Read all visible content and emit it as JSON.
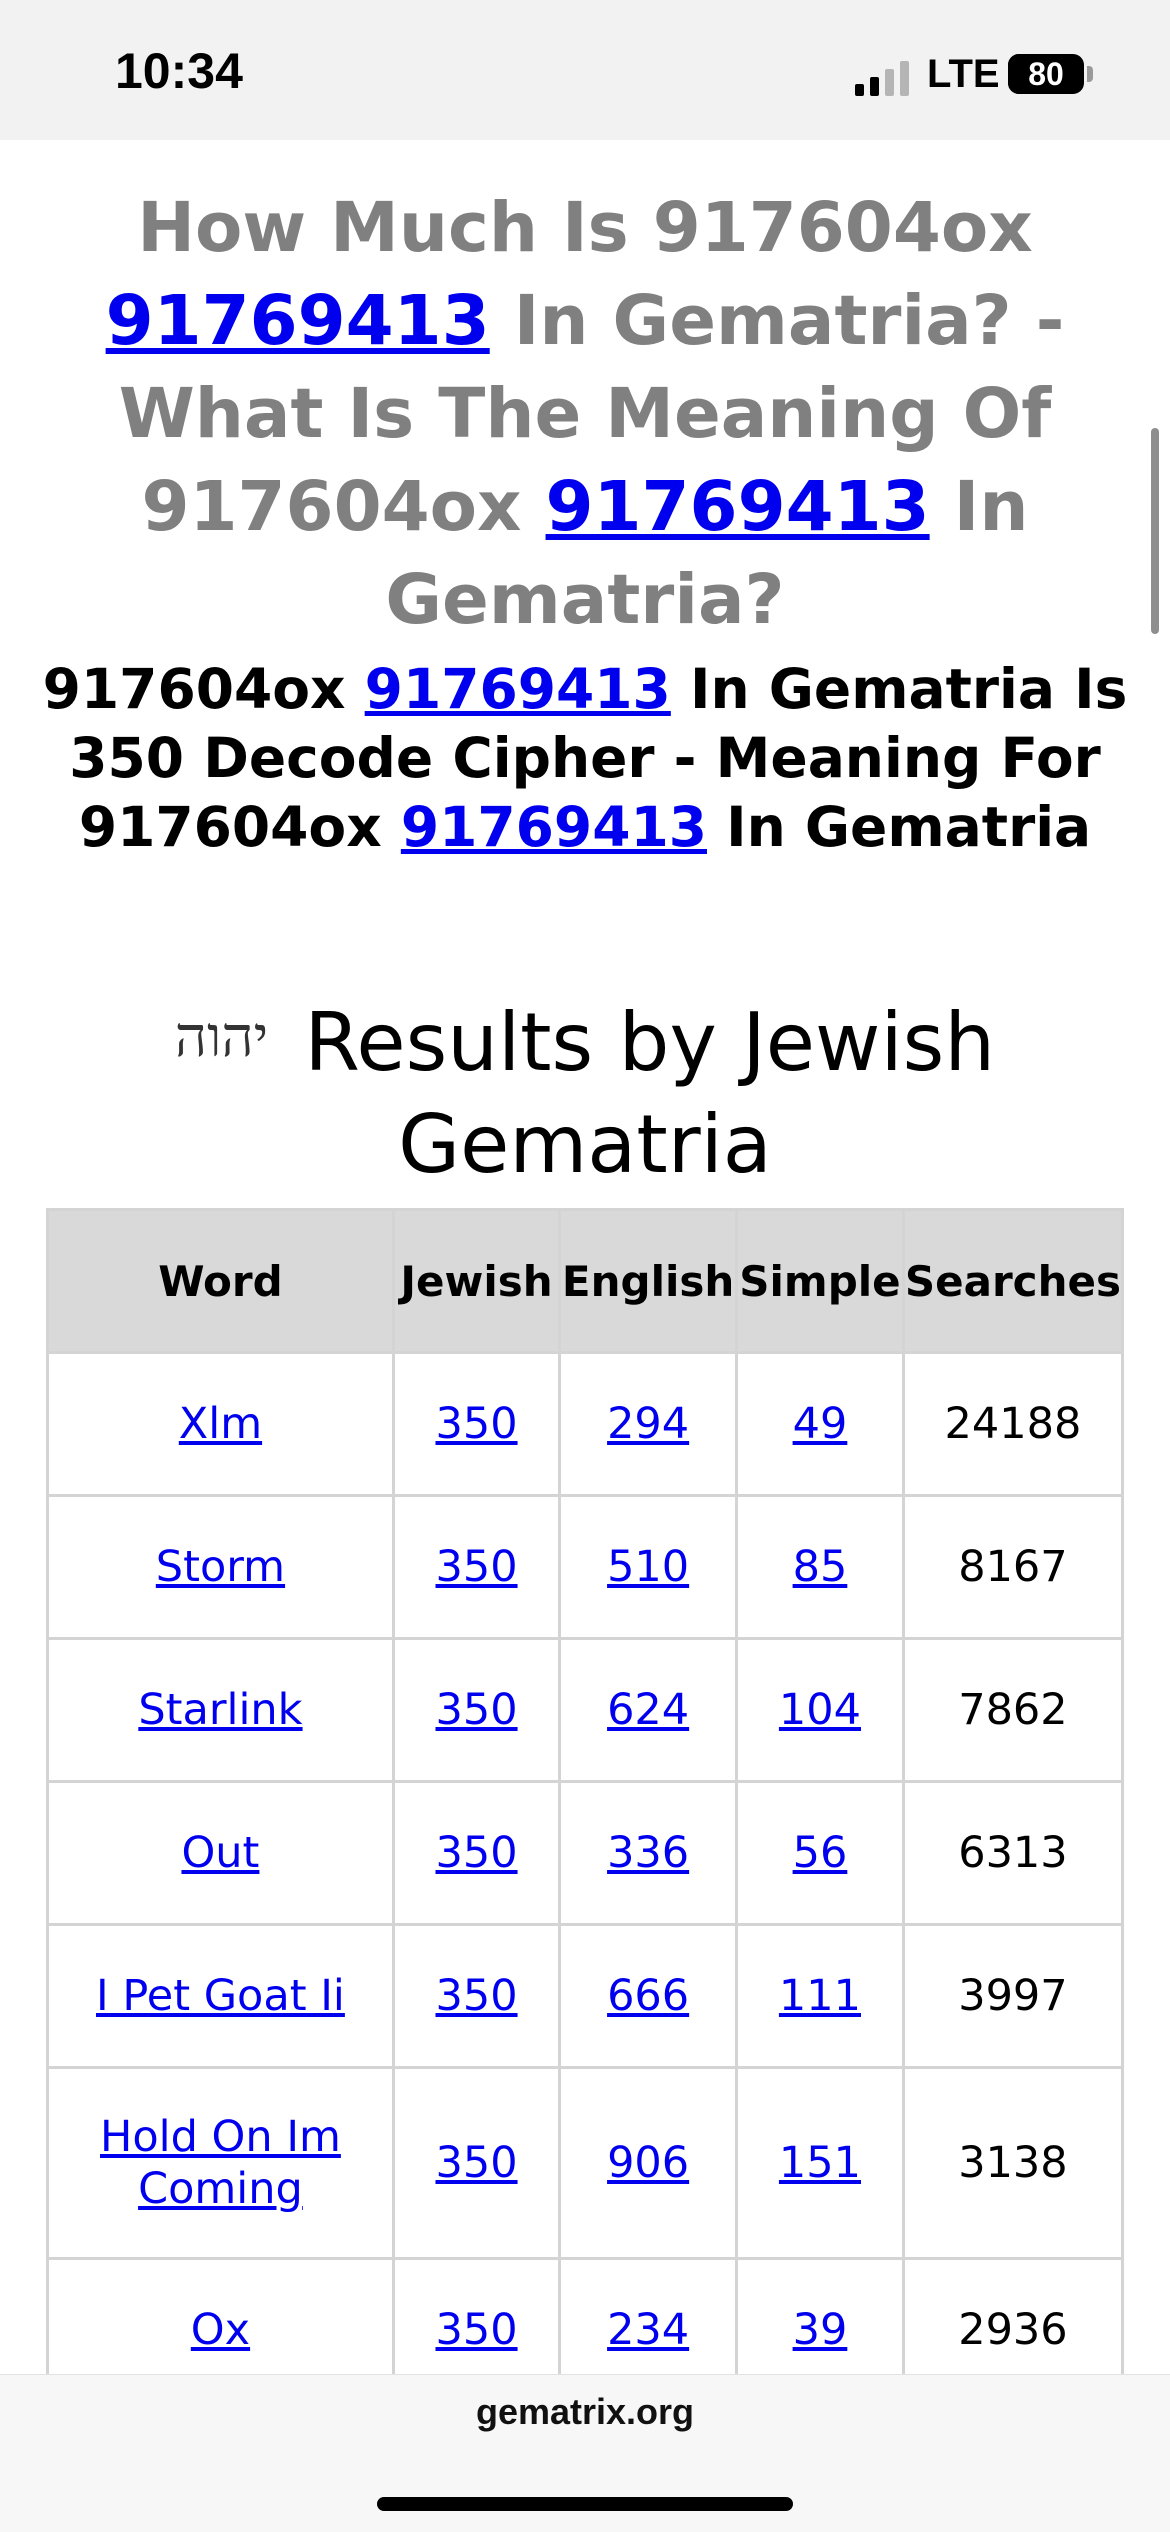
{
  "status_bar": {
    "time": "10:34",
    "network": "LTE",
    "battery": "80",
    "battery_level": 0.8,
    "signal_bars_active": 2,
    "signal_bars_total": 4
  },
  "page": {
    "heading_parts": [
      "How Much Is 917604ox ",
      "91769413",
      " In Gematria? - What Is The Meaning Of 917604ox ",
      "91769413",
      " In Gematria?"
    ],
    "subheading_parts": [
      "917604ox ",
      "91769413",
      " In Gematria Is 350 Decode Cipher - Meaning For 917604ox ",
      "91769413",
      " In Gematria"
    ],
    "section_title": "Results by Jewish Gematria",
    "hebrew_icon": "יהוה"
  },
  "table": {
    "headers": [
      "Word",
      "Jewish",
      "English",
      "Simple",
      "Searches"
    ],
    "rows": [
      {
        "word": "Xlm",
        "jewish": "350",
        "english": "294",
        "simple": "49",
        "searches": "24188"
      },
      {
        "word": "Storm",
        "jewish": "350",
        "english": "510",
        "simple": "85",
        "searches": "8167"
      },
      {
        "word": "Starlink",
        "jewish": "350",
        "english": "624",
        "simple": "104",
        "searches": "7862"
      },
      {
        "word": "Out",
        "jewish": "350",
        "english": "336",
        "simple": "56",
        "searches": "6313"
      },
      {
        "word": "I Pet Goat Ii",
        "jewish": "350",
        "english": "666",
        "simple": "111",
        "searches": "3997"
      },
      {
        "word": "Hold On Im Coming",
        "jewish": "350",
        "english": "906",
        "simple": "151",
        "searches": "3138"
      },
      {
        "word": "Ox",
        "jewish": "350",
        "english": "234",
        "simple": "39",
        "searches": "2936"
      }
    ]
  },
  "browser": {
    "url": "gematrix.org"
  },
  "colors": {
    "heading_gray": "#808080",
    "link_blue": "#0000ee",
    "table_header_bg": "#d9d9d9",
    "table_border": "#d4d4d4"
  }
}
